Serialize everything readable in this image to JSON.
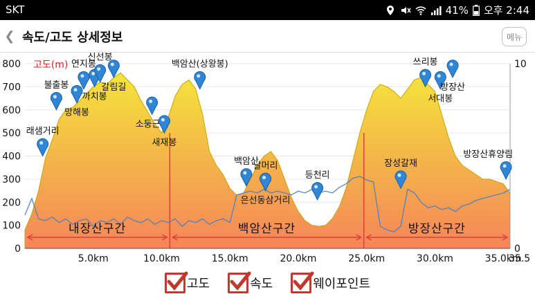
{
  "status_bar": {
    "carrier": "SKT",
    "battery": "41%",
    "time": "오후 2:44"
  },
  "app_bar": {
    "back_icon": "back-chevron-icon",
    "title": "속도/고도 상세정보",
    "menu_label": "메뉴"
  },
  "colors": {
    "elevation_top": "#f3e43a",
    "elevation_bottom": "#f5855a",
    "speed_line": "#4a7fc0",
    "section_arrow": "#e43b3b",
    "altitude_label": "#e02020",
    "checkbox": "#c0392b",
    "marker": "#2f86d6"
  },
  "legend": {
    "items": [
      {
        "label": "고도",
        "checked": true
      },
      {
        "label": "속도",
        "checked": true
      },
      {
        "label": "웨이포인트",
        "checked": true
      }
    ]
  },
  "chart_data": {
    "type": "area",
    "xlabel": "",
    "y_left_label": "고도(m)",
    "y_left_range": [
      0,
      800
    ],
    "y_left_ticks": [
      "800",
      "700",
      "600",
      "500",
      "400",
      "300",
      "200",
      "100",
      "0"
    ],
    "y_right_range": [
      0,
      10
    ],
    "y_right_ticks": [
      "10",
      "0"
    ],
    "x_range": [
      0,
      35.5
    ],
    "x_ticks": [
      {
        "x": 5,
        "label": "5.0km"
      },
      {
        "x": 10,
        "label": "10.0km"
      },
      {
        "x": 15,
        "label": "15.0km"
      },
      {
        "x": 20,
        "label": "20.0km"
      },
      {
        "x": 25,
        "label": "25.0km"
      },
      {
        "x": 30,
        "label": "30.0km"
      },
      {
        "x": 35,
        "label": "35.0km"
      },
      {
        "x": 35.5,
        "label": "35.5"
      }
    ],
    "elevation": {
      "x": [
        0,
        0.5,
        1,
        1.5,
        2,
        2.5,
        3,
        3.5,
        4,
        4.5,
        5,
        5.5,
        6,
        6.5,
        7,
        7.5,
        8,
        8.5,
        9,
        9.5,
        10,
        10.5,
        11,
        11.5,
        12,
        12.5,
        13,
        13.5,
        14,
        14.5,
        15,
        15.5,
        16,
        16.5,
        17,
        17.5,
        18,
        18.5,
        19,
        19.5,
        20,
        20.5,
        21,
        21.5,
        22,
        22.5,
        23,
        23.5,
        24,
        24.5,
        25,
        25.5,
        26,
        26.5,
        27,
        27.5,
        28,
        28.5,
        29,
        29.5,
        30,
        30.5,
        31,
        31.5,
        32,
        32.5,
        33,
        33.5,
        34,
        34.5,
        35,
        35.5
      ],
      "values": [
        80,
        150,
        250,
        390,
        470,
        560,
        600,
        610,
        640,
        670,
        700,
        720,
        710,
        740,
        760,
        730,
        700,
        640,
        590,
        540,
        500,
        570,
        660,
        710,
        730,
        690,
        580,
        420,
        360,
        320,
        260,
        230,
        240,
        300,
        360,
        400,
        420,
        380,
        300,
        220,
        160,
        120,
        100,
        95,
        100,
        130,
        180,
        260,
        380,
        500,
        600,
        680,
        710,
        700,
        680,
        650,
        690,
        730,
        740,
        710,
        680,
        580,
        480,
        400,
        360,
        340,
        320,
        300,
        300,
        290,
        280,
        240
      ],
      "peak_note": ""
    },
    "speed": {
      "x": [
        0,
        0.5,
        1,
        1.5,
        2,
        2.5,
        3,
        3.5,
        4,
        4.5,
        5,
        5.5,
        6,
        6.5,
        7,
        7.5,
        8,
        8.5,
        9,
        9.5,
        10,
        10.5,
        11,
        11.5,
        12,
        12.5,
        13,
        13.5,
        14,
        14.5,
        15,
        15.5,
        16,
        16.5,
        17,
        17.5,
        18,
        18.5,
        19,
        19.5,
        20,
        20.5,
        21,
        21.5,
        22,
        22.5,
        23,
        23.5,
        24,
        24.5,
        25,
        25.5,
        26,
        26.5,
        27,
        27.5,
        28,
        28.5,
        29,
        29.5,
        30,
        30.5,
        31,
        31.5,
        32,
        32.5,
        33,
        33.5,
        34,
        34.5,
        35,
        35.5
      ],
      "values": [
        1.8,
        2.7,
        1.6,
        1.5,
        1.7,
        1.4,
        1.6,
        1.3,
        1.5,
        1.6,
        1.2,
        1.5,
        1.4,
        1.6,
        1.3,
        1.7,
        1.5,
        1.4,
        1.6,
        1.3,
        1.5,
        1.4,
        1.6,
        1.2,
        1.5,
        1.4,
        1.6,
        1.3,
        1.5,
        1.6,
        1.4,
        2.9,
        3.0,
        3.1,
        3.0,
        3.2,
        3.0,
        3.1,
        3.0,
        2.9,
        3.1,
        3.0,
        3.2,
        3.0,
        3.1,
        3.0,
        3.3,
        3.5,
        3.8,
        3.9,
        3.7,
        3.6,
        1.2,
        1.0,
        0.9,
        1.2,
        3.2,
        3.0,
        2.5,
        2.2,
        2.3,
        2.1,
        2.2,
        2.0,
        2.3,
        2.4,
        2.6,
        2.7,
        2.8,
        2.9,
        3.0,
        3.2
      ]
    },
    "sections": [
      {
        "label": "내장산구간",
        "x_start": 0,
        "x_end": 10.6
      },
      {
        "label": "백암산구간",
        "x_start": 10.6,
        "x_end": 24.8
      },
      {
        "label": "방장산구간",
        "x_start": 24.8,
        "x_end": 35.5
      }
    ],
    "section_dividers": [
      10.6,
      24.8
    ],
    "waypoints": [
      {
        "name": "래샘거리",
        "x": 1.3,
        "y": 400,
        "label_dx": 0,
        "label_dy": -1
      },
      {
        "name": "불출봉",
        "x": 2.3,
        "y": 600,
        "label_dx": 0,
        "label_dy": -1
      },
      {
        "name": "망해봉",
        "x": 3.8,
        "y": 630,
        "label_dx": 0,
        "label_dy": 1
      },
      {
        "name": "연지봉",
        "x": 4.3,
        "y": 690,
        "label_dx": 0,
        "label_dy": -1
      },
      {
        "name": "까치봉",
        "x": 5.1,
        "y": 700,
        "label_dx": 0,
        "label_dy": 1
      },
      {
        "name": "신선봉",
        "x": 5.5,
        "y": 720,
        "label_dx": 0,
        "label_dy": -1
      },
      {
        "name": "갈림길",
        "x": 6.5,
        "y": 740,
        "label_dx": 0,
        "label_dy": 1
      },
      {
        "name": "소둥근재",
        "x": 9.3,
        "y": 580,
        "label_dx": 0,
        "label_dy": 1
      },
      {
        "name": "새재봉",
        "x": 10.2,
        "y": 500,
        "label_dx": 0,
        "label_dy": 1
      },
      {
        "name": "백암산(상왕봉)",
        "x": 12.8,
        "y": 690,
        "label_dx": 0,
        "label_dy": -1
      },
      {
        "name": "백암산",
        "x": 16.2,
        "y": 270,
        "label_dx": 0,
        "label_dy": -1
      },
      {
        "name": "날머리",
        "x": 17.6,
        "y": 250,
        "label_dx": 0,
        "label_dy": -1
      },
      {
        "name": "은선동삼거리",
        "x": 17.6,
        "y": 250,
        "label_dx": 0,
        "label_dy": 1
      },
      {
        "name": "등천리",
        "x": 21.4,
        "y": 210,
        "label_dx": 0,
        "label_dy": -1
      },
      {
        "name": "장성갈재",
        "x": 27.5,
        "y": 260,
        "label_dx": 0,
        "label_dy": -1
      },
      {
        "name": "쓰리봉",
        "x": 29.3,
        "y": 700,
        "label_dx": 0,
        "label_dy": -1
      },
      {
        "name": "서대봉",
        "x": 30.4,
        "y": 690,
        "label_dx": 0,
        "label_dy": 1
      },
      {
        "name": "방장산",
        "x": 31.3,
        "y": 740,
        "label_dx": 0,
        "label_dy": 1
      },
      {
        "name": "방장산휴양림",
        "x": 35.2,
        "y": 300,
        "label_dx": 0,
        "label_dy": -1
      }
    ]
  }
}
